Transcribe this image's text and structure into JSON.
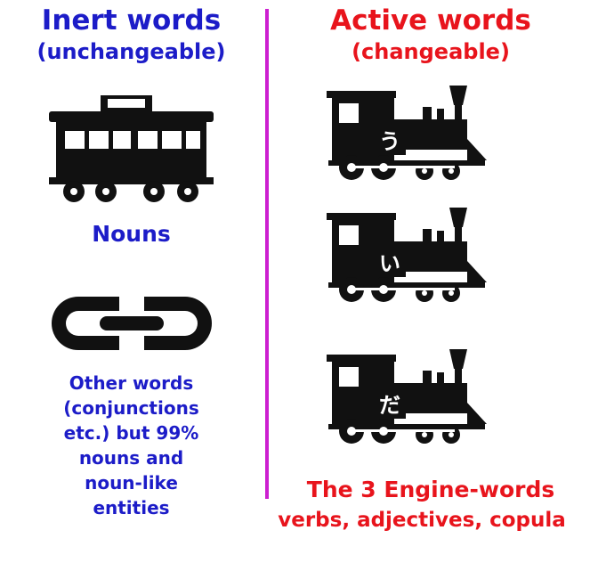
{
  "left": {
    "title": "Inert words",
    "subtitle": "(unchangeable)",
    "nouns_label": "Nouns",
    "other_lines": [
      "Other words",
      "(conjunctions",
      "etc.) but 99%",
      "nouns and",
      "noun-like",
      "entities"
    ],
    "icons": [
      "railway-carriage-icon",
      "chain-link-icon"
    ]
  },
  "right": {
    "title": "Active words",
    "subtitle": "(changeable)",
    "engines": [
      {
        "char": "う",
        "icon": "locomotive-icon"
      },
      {
        "char": "い",
        "icon": "locomotive-icon"
      },
      {
        "char": "だ",
        "icon": "locomotive-icon"
      }
    ],
    "engine_words_label": "The 3 Engine-words",
    "engine_words_sub": "verbs, adjectives, copula"
  },
  "colors": {
    "inert": "#1c1cc8",
    "active": "#e8141c",
    "divider": "#cc1fd0"
  }
}
